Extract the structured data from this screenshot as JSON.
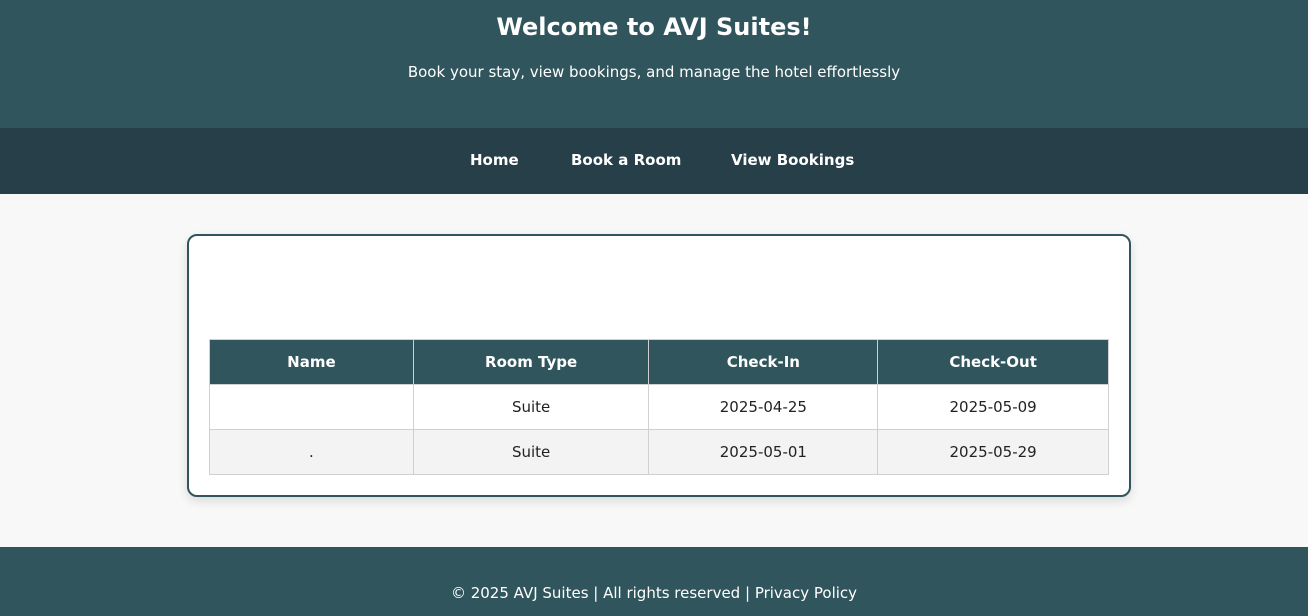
{
  "header": {
    "title": "Welcome to AVJ Suites!",
    "subtitle": "Book your stay, view bookings, and manage the hotel effortlessly"
  },
  "nav": {
    "home": "Home",
    "book": "Book a Room",
    "view": "View Bookings"
  },
  "table": {
    "headers": [
      "Name",
      "Room Type",
      "Check-In",
      "Check-Out"
    ],
    "rows": [
      {
        "name": "",
        "room_type": "Suite",
        "check_in": "2025-04-25",
        "check_out": "2025-05-09"
      },
      {
        "name": ".",
        "room_type": "Suite",
        "check_in": "2025-05-01",
        "check_out": "2025-05-29"
      }
    ]
  },
  "footer": {
    "copyright": "© 2025 AVJ Suites | All rights reserved |",
    "privacy": "Privacy Policy"
  },
  "colors": {
    "header_bg": "#30555d",
    "nav_bg": "#263f48",
    "page_bg": "#f8f8f8",
    "row_alt_bg": "#f3f3f3"
  }
}
